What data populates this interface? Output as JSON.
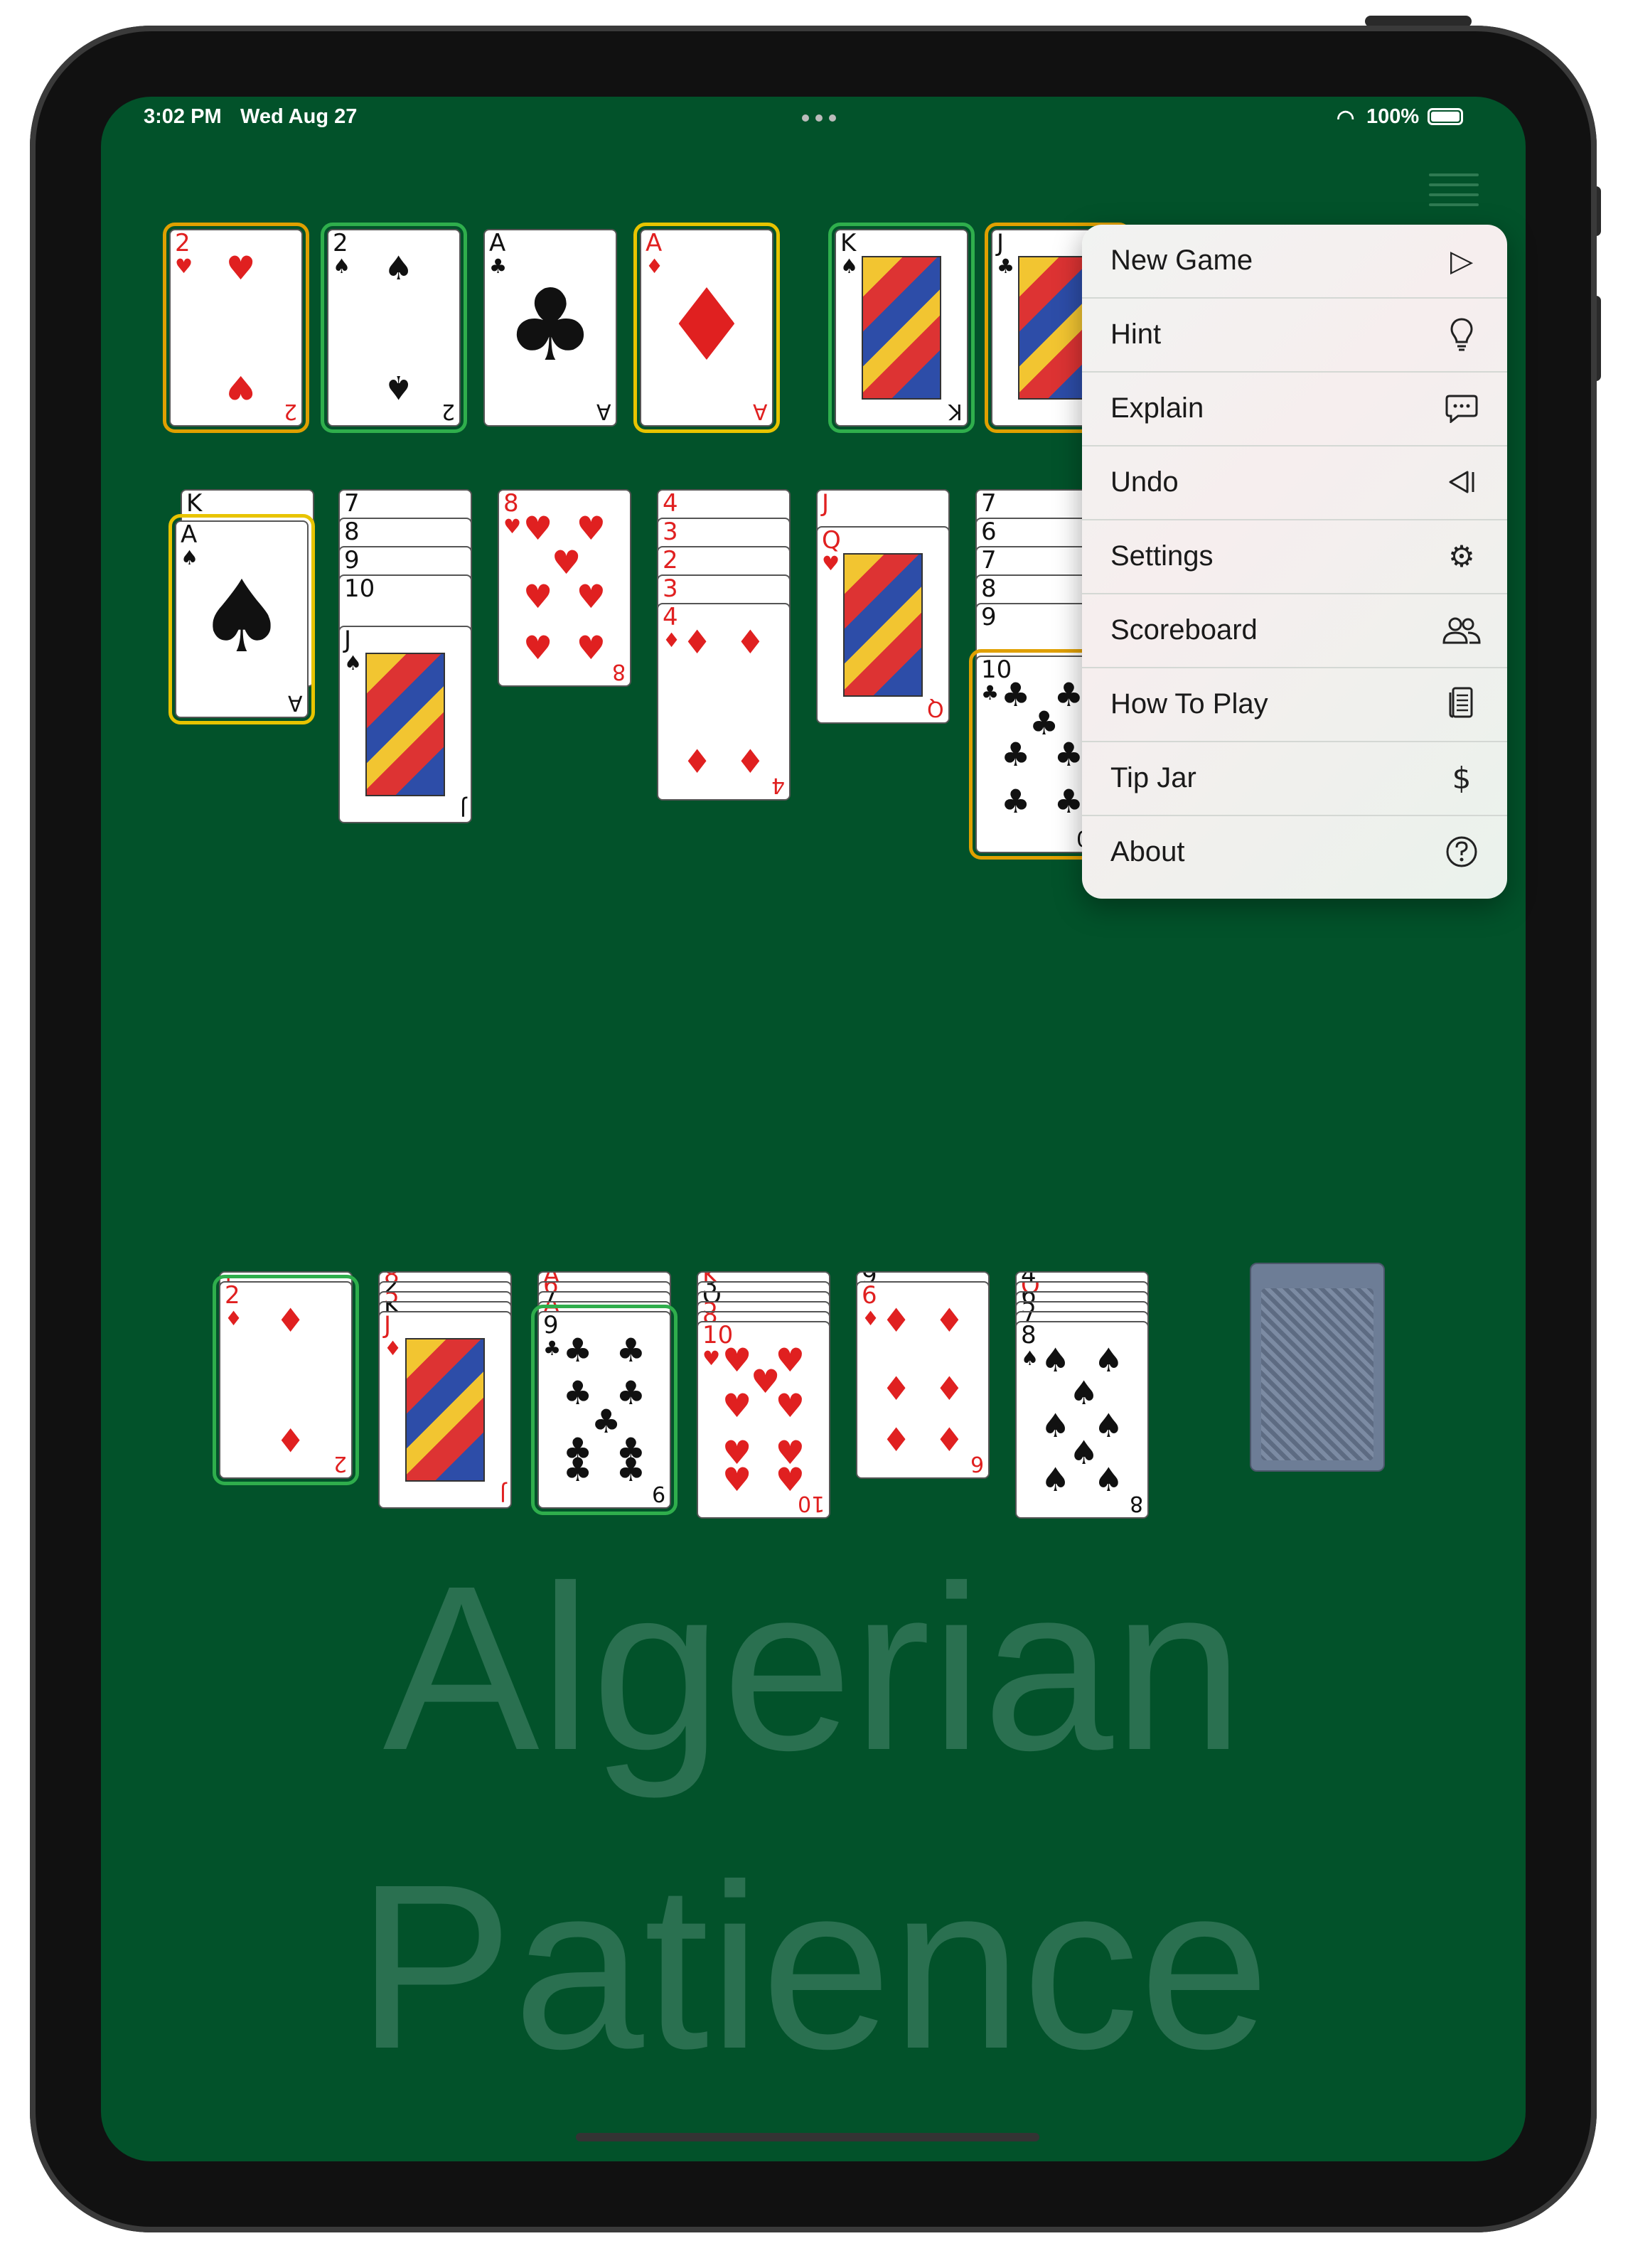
{
  "status": {
    "time": "3:02 PM",
    "date": "Wed Aug 27",
    "battery": "100%"
  },
  "watermark": {
    "line1": "Algerian",
    "line2": "Patience"
  },
  "menu": {
    "items": [
      {
        "label": "New Game",
        "icon": "play-icon"
      },
      {
        "label": "Hint",
        "icon": "lightbulb-icon"
      },
      {
        "label": "Explain",
        "icon": "speech-bubble-icon"
      },
      {
        "label": "Undo",
        "icon": "undo-icon"
      },
      {
        "label": "Settings",
        "icon": "gear-icon"
      },
      {
        "label": "Scoreboard",
        "icon": "people-icon"
      },
      {
        "label": "How To Play",
        "icon": "book-icon"
      },
      {
        "label": "Tip Jar",
        "icon": "dollar-icon"
      },
      {
        "label": "About",
        "icon": "question-icon"
      }
    ]
  },
  "foundations": [
    {
      "rank": "2",
      "suit": "♥"
    },
    {
      "rank": "2",
      "suit": "♠"
    },
    {
      "rank": "A",
      "suit": "♣"
    },
    {
      "rank": "A",
      "suit": "♦"
    },
    {
      "rank": "K",
      "suit": "♠"
    },
    {
      "rank": "J",
      "suit": "♣"
    }
  ],
  "top_piles": [
    {
      "under": [
        "K"
      ],
      "top": {
        "rank": "A",
        "suit": "♠"
      }
    },
    {
      "under": [
        "7",
        "8",
        "9",
        "10"
      ],
      "top": {
        "rank": "J",
        "suit": "♠"
      }
    },
    {
      "under": [],
      "top": {
        "rank": "8",
        "suit": "♥"
      }
    },
    {
      "under": [
        "4",
        "3",
        "2",
        "3"
      ],
      "top": {
        "rank": "4",
        "suit": "♦"
      }
    },
    {
      "under": [
        "J"
      ],
      "top": {
        "rank": "Q",
        "suit": "♥"
      }
    },
    {
      "under": [
        "7",
        "6",
        "7",
        "8",
        "9"
      ],
      "top": {
        "rank": "10",
        "suit": "♣"
      }
    }
  ],
  "bottom_piles": [
    {
      "under": [
        "5"
      ],
      "top": {
        "rank": "2",
        "suit": "♦"
      }
    },
    {
      "under": [
        "8",
        "2",
        "5",
        "K"
      ],
      "top": {
        "rank": "J",
        "suit": "♦"
      }
    },
    {
      "under": [
        "A",
        "6",
        "7",
        "A"
      ],
      "top": {
        "rank": "9",
        "suit": "♣"
      }
    },
    {
      "under": [
        "K",
        "3",
        "Q",
        "5",
        "8"
      ],
      "top": {
        "rank": "10",
        "suit": "♥"
      }
    },
    {
      "under": [
        "9"
      ],
      "top": {
        "rank": "6",
        "suit": "♦"
      }
    },
    {
      "under": [
        "4",
        "Q",
        "6",
        "5",
        "7"
      ],
      "top": {
        "rank": "8",
        "suit": "♠"
      }
    }
  ]
}
